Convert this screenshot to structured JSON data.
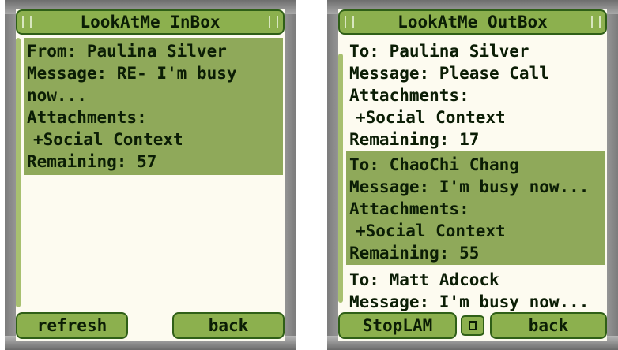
{
  "inbox": {
    "title": "LookAtMe InBox",
    "message": {
      "from": "From: Paulina Silver",
      "message_line1": "Message: RE- I'm busy",
      "message_line2": "now...",
      "attachments_label": "Attachments:",
      "attachment": "+Social Context",
      "remaining": "Remaining: 57"
    },
    "softkeys": {
      "left": "refresh",
      "right": "back"
    }
  },
  "outbox": {
    "title": "LookAtMe OutBox",
    "messages": [
      {
        "to": "To: Paulina Silver",
        "message": "Message: Please Call",
        "attachments_label": "Attachments:",
        "attachment": "+Social Context",
        "remaining": "Remaining: 17"
      },
      {
        "to": "To: ChaoChi Chang",
        "message": "Message: I'm busy now...",
        "attachments_label": "Attachments:",
        "attachment": "+Social Context",
        "remaining": "Remaining: 55"
      },
      {
        "to": "To: Matt Adcock",
        "message": "Message: I'm busy now..."
      }
    ],
    "softkeys": {
      "left": "StopLAM",
      "menu_icon": "menu-icon",
      "right": "back"
    }
  },
  "colors": {
    "screen_bg": "#fdfbf0",
    "bar_green": "#8cb04e",
    "selected_green": "#8fa95a",
    "text_dark": "#0b1d05"
  }
}
